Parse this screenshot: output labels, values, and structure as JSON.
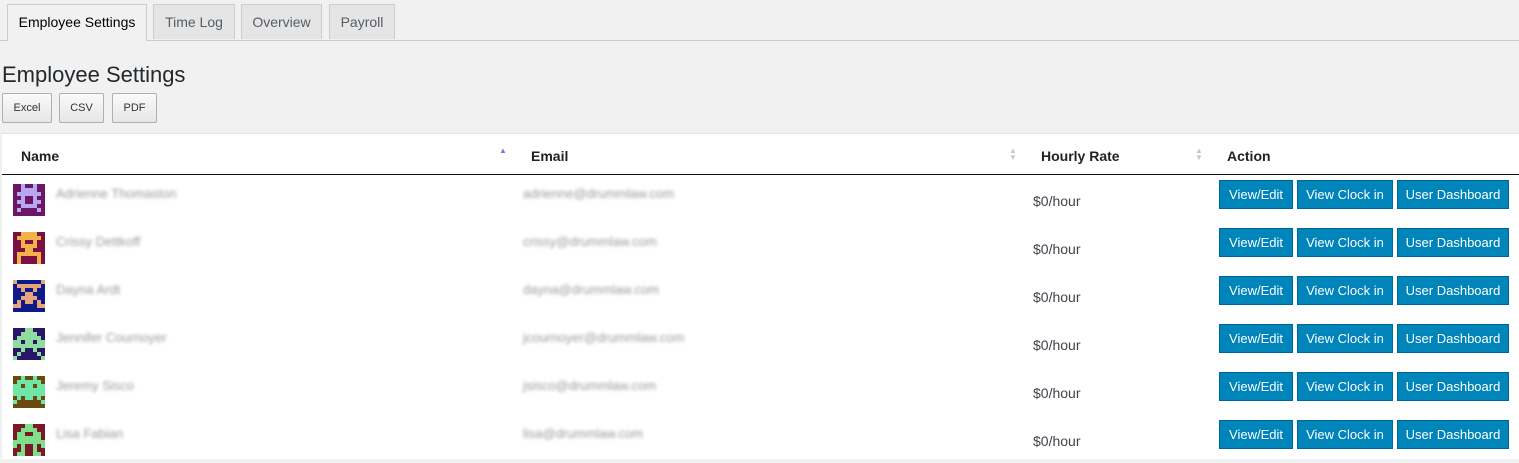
{
  "tabs": [
    {
      "label": "Employee Settings",
      "active": true
    },
    {
      "label": "Time Log",
      "active": false
    },
    {
      "label": "Overview",
      "active": false
    },
    {
      "label": "Payroll",
      "active": false
    }
  ],
  "page": {
    "title": "Employee Settings"
  },
  "export_buttons": {
    "excel": "Excel",
    "csv": "CSV",
    "pdf": "PDF"
  },
  "table": {
    "columns": {
      "name": "Name",
      "email": "Email",
      "hourly_rate": "Hourly Rate",
      "action": "Action"
    },
    "sort": {
      "column": "Name",
      "direction": "ascending"
    },
    "actions": {
      "view_edit": "View/Edit",
      "view_clock_in": "View Clock in",
      "user_dashboard": "User Dashboard"
    },
    "rows": [
      {
        "name": "Adrienne Thomaston",
        "email": "adrienne@drummlaw.com",
        "rate": "$0/hour"
      },
      {
        "name": "Crissy Dettkoff",
        "email": "crissy@drummlaw.com",
        "rate": "$0/hour"
      },
      {
        "name": "Dayna Ardt",
        "email": "dayna@drummlaw.com",
        "rate": "$0/hour"
      },
      {
        "name": "Jennifer Cournoyer",
        "email": "jcournoyer@drummlaw.com",
        "rate": "$0/hour"
      },
      {
        "name": "Jeremy Sisco",
        "email": "jsisco@drummlaw.com",
        "rate": "$0/hour"
      },
      {
        "name": "Lisa Fabian",
        "email": "lisa@drummlaw.com",
        "rate": "$0/hour"
      }
    ]
  },
  "colors": {
    "accent": "#0085ba",
    "avatars": [
      {
        "bg": "#6b1766",
        "fg": "#b9a6f2"
      },
      {
        "bg": "#7a1043",
        "fg": "#f2b24a"
      },
      {
        "bg": "#0e1a8a",
        "fg": "#e6a679"
      },
      {
        "bg": "#2b1568",
        "fg": "#8fdca0"
      },
      {
        "bg": "#6b4a10",
        "fg": "#6fe6a6"
      },
      {
        "bg": "#7a1828",
        "fg": "#7fe08a"
      }
    ]
  }
}
